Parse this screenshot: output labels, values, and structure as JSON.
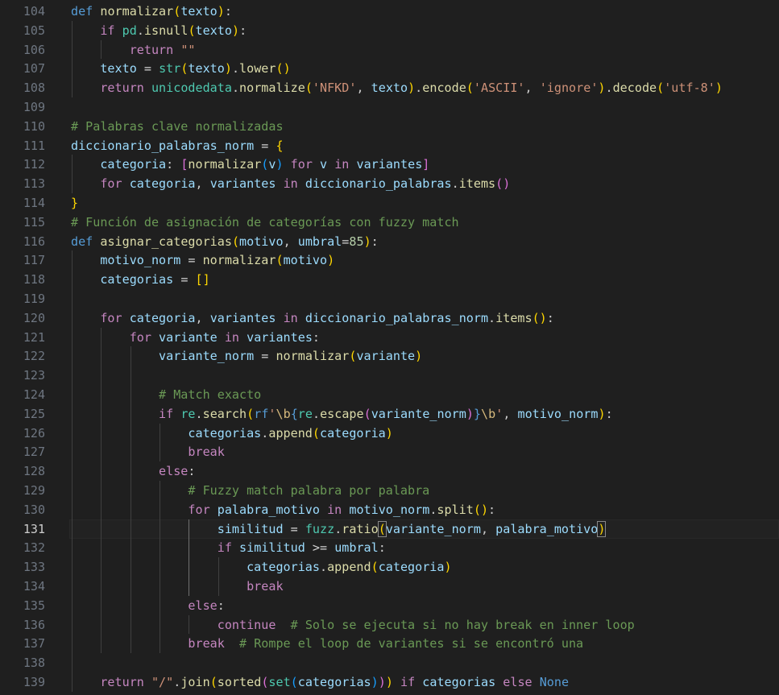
{
  "editor": {
    "active_line": 131,
    "colors": {
      "background": "#1f1f1f",
      "line_number": "#6e7681",
      "active_line_number": "#cccccc",
      "keyword": "#569cd6",
      "control": "#c586c0",
      "function": "#dcdcaa",
      "variable": "#9cdcfe",
      "string": "#ce9178",
      "number": "#b5cea8",
      "comment": "#6a9955"
    },
    "lines": [
      {
        "n": "104",
        "i": 0,
        "t": [
          [
            "kw",
            "def"
          ],
          [
            "plain",
            " "
          ],
          [
            "fn",
            "normalizar"
          ],
          [
            "p1",
            "("
          ],
          [
            "var",
            "texto"
          ],
          [
            "p1",
            ")"
          ],
          [
            "plain",
            ":"
          ]
        ]
      },
      {
        "n": "105",
        "i": 1,
        "t": [
          [
            "ctrl",
            "if"
          ],
          [
            "plain",
            " "
          ],
          [
            "cls",
            "pd"
          ],
          [
            "plain",
            "."
          ],
          [
            "fn",
            "isnull"
          ],
          [
            "p1",
            "("
          ],
          [
            "var",
            "texto"
          ],
          [
            "p1",
            ")"
          ],
          [
            "plain",
            ":"
          ]
        ]
      },
      {
        "n": "106",
        "i": 2,
        "t": [
          [
            "ctrl",
            "return"
          ],
          [
            "plain",
            " "
          ],
          [
            "str",
            "\"\""
          ]
        ]
      },
      {
        "n": "107",
        "i": 1,
        "t": [
          [
            "var",
            "texto"
          ],
          [
            "plain",
            " "
          ],
          [
            "op",
            "="
          ],
          [
            "plain",
            " "
          ],
          [
            "cls",
            "str"
          ],
          [
            "p1",
            "("
          ],
          [
            "var",
            "texto"
          ],
          [
            "p1",
            ")"
          ],
          [
            "plain",
            "."
          ],
          [
            "fn",
            "lower"
          ],
          [
            "p1",
            "()"
          ]
        ]
      },
      {
        "n": "108",
        "i": 1,
        "t": [
          [
            "ctrl",
            "return"
          ],
          [
            "plain",
            " "
          ],
          [
            "cls",
            "unicodedata"
          ],
          [
            "plain",
            "."
          ],
          [
            "fn",
            "normalize"
          ],
          [
            "p1",
            "("
          ],
          [
            "str",
            "'NFKD'"
          ],
          [
            "plain",
            ", "
          ],
          [
            "var",
            "texto"
          ],
          [
            "p1",
            ")"
          ],
          [
            "plain",
            "."
          ],
          [
            "fn",
            "encode"
          ],
          [
            "p1",
            "("
          ],
          [
            "str",
            "'ASCII'"
          ],
          [
            "plain",
            ", "
          ],
          [
            "str",
            "'ignore'"
          ],
          [
            "p1",
            ")"
          ],
          [
            "plain",
            "."
          ],
          [
            "fn",
            "decode"
          ],
          [
            "p1",
            "("
          ],
          [
            "str",
            "'utf-8'"
          ],
          [
            "p1",
            ")"
          ]
        ]
      },
      {
        "n": "109",
        "i": 0,
        "t": []
      },
      {
        "n": "110",
        "i": 0,
        "t": [
          [
            "cm",
            "# Palabras clave normalizadas"
          ]
        ]
      },
      {
        "n": "111",
        "i": 0,
        "t": [
          [
            "var",
            "diccionario_palabras_norm"
          ],
          [
            "plain",
            " "
          ],
          [
            "op",
            "="
          ],
          [
            "plain",
            " "
          ],
          [
            "p1",
            "{"
          ]
        ]
      },
      {
        "n": "112",
        "i": 1,
        "t": [
          [
            "var",
            "categoria"
          ],
          [
            "plain",
            ": "
          ],
          [
            "p2",
            "["
          ],
          [
            "fn",
            "normalizar"
          ],
          [
            "p3",
            "("
          ],
          [
            "var",
            "v"
          ],
          [
            "p3",
            ")"
          ],
          [
            "plain",
            " "
          ],
          [
            "ctrl",
            "for"
          ],
          [
            "plain",
            " "
          ],
          [
            "var",
            "v"
          ],
          [
            "plain",
            " "
          ],
          [
            "ctrl",
            "in"
          ],
          [
            "plain",
            " "
          ],
          [
            "var",
            "variantes"
          ],
          [
            "p2",
            "]"
          ]
        ]
      },
      {
        "n": "113",
        "i": 1,
        "t": [
          [
            "ctrl",
            "for"
          ],
          [
            "plain",
            " "
          ],
          [
            "var",
            "categoria"
          ],
          [
            "plain",
            ", "
          ],
          [
            "var",
            "variantes"
          ],
          [
            "plain",
            " "
          ],
          [
            "ctrl",
            "in"
          ],
          [
            "plain",
            " "
          ],
          [
            "var",
            "diccionario_palabras"
          ],
          [
            "plain",
            "."
          ],
          [
            "fn",
            "items"
          ],
          [
            "p2",
            "()"
          ]
        ]
      },
      {
        "n": "114",
        "i": 0,
        "t": [
          [
            "p1",
            "}"
          ]
        ]
      },
      {
        "n": "115",
        "i": 0,
        "t": [
          [
            "cm",
            "# Función de asignación de categorías con fuzzy match"
          ]
        ]
      },
      {
        "n": "116",
        "i": 0,
        "t": [
          [
            "kw",
            "def"
          ],
          [
            "plain",
            " "
          ],
          [
            "fn",
            "asignar_categorias"
          ],
          [
            "p1",
            "("
          ],
          [
            "var",
            "motivo"
          ],
          [
            "plain",
            ", "
          ],
          [
            "var",
            "umbral"
          ],
          [
            "op",
            "="
          ],
          [
            "num",
            "85"
          ],
          [
            "p1",
            ")"
          ],
          [
            "plain",
            ":"
          ]
        ]
      },
      {
        "n": "117",
        "i": 1,
        "t": [
          [
            "var",
            "motivo_norm"
          ],
          [
            "plain",
            " "
          ],
          [
            "op",
            "="
          ],
          [
            "plain",
            " "
          ],
          [
            "fn",
            "normalizar"
          ],
          [
            "p1",
            "("
          ],
          [
            "var",
            "motivo"
          ],
          [
            "p1",
            ")"
          ]
        ]
      },
      {
        "n": "118",
        "i": 1,
        "t": [
          [
            "var",
            "categorias"
          ],
          [
            "plain",
            " "
          ],
          [
            "op",
            "="
          ],
          [
            "plain",
            " "
          ],
          [
            "p1",
            "[]"
          ]
        ]
      },
      {
        "n": "119",
        "i": 1,
        "t": []
      },
      {
        "n": "120",
        "i": 1,
        "t": [
          [
            "ctrl",
            "for"
          ],
          [
            "plain",
            " "
          ],
          [
            "var",
            "categoria"
          ],
          [
            "plain",
            ", "
          ],
          [
            "var",
            "variantes"
          ],
          [
            "plain",
            " "
          ],
          [
            "ctrl",
            "in"
          ],
          [
            "plain",
            " "
          ],
          [
            "var",
            "diccionario_palabras_norm"
          ],
          [
            "plain",
            "."
          ],
          [
            "fn",
            "items"
          ],
          [
            "p1",
            "()"
          ],
          [
            "plain",
            ":"
          ]
        ]
      },
      {
        "n": "121",
        "i": 2,
        "t": [
          [
            "ctrl",
            "for"
          ],
          [
            "plain",
            " "
          ],
          [
            "var",
            "variante"
          ],
          [
            "plain",
            " "
          ],
          [
            "ctrl",
            "in"
          ],
          [
            "plain",
            " "
          ],
          [
            "var",
            "variantes"
          ],
          [
            "plain",
            ":"
          ]
        ]
      },
      {
        "n": "122",
        "i": 3,
        "t": [
          [
            "var",
            "variante_norm"
          ],
          [
            "plain",
            " "
          ],
          [
            "op",
            "="
          ],
          [
            "plain",
            " "
          ],
          [
            "fn",
            "normalizar"
          ],
          [
            "p1",
            "("
          ],
          [
            "var",
            "variante"
          ],
          [
            "p1",
            ")"
          ]
        ]
      },
      {
        "n": "123",
        "i": 3,
        "t": []
      },
      {
        "n": "124",
        "i": 3,
        "t": [
          [
            "cm",
            "# Match exacto"
          ]
        ]
      },
      {
        "n": "125",
        "i": 3,
        "t": [
          [
            "ctrl",
            "if"
          ],
          [
            "plain",
            " "
          ],
          [
            "cls",
            "re"
          ],
          [
            "plain",
            "."
          ],
          [
            "fn",
            "search"
          ],
          [
            "p1",
            "("
          ],
          [
            "kw",
            "rf"
          ],
          [
            "str",
            "'"
          ],
          [
            "esc",
            "\\b"
          ],
          [
            "kw",
            "{"
          ],
          [
            "cls",
            "re"
          ],
          [
            "plain",
            "."
          ],
          [
            "fn",
            "escape"
          ],
          [
            "p2",
            "("
          ],
          [
            "var",
            "variante_norm"
          ],
          [
            "p2",
            ")"
          ],
          [
            "kw",
            "}"
          ],
          [
            "esc",
            "\\b"
          ],
          [
            "str",
            "'"
          ],
          [
            "plain",
            ", "
          ],
          [
            "var",
            "motivo_norm"
          ],
          [
            "p1",
            ")"
          ],
          [
            "plain",
            ":"
          ]
        ]
      },
      {
        "n": "126",
        "i": 4,
        "t": [
          [
            "var",
            "categorias"
          ],
          [
            "plain",
            "."
          ],
          [
            "fn",
            "append"
          ],
          [
            "p1",
            "("
          ],
          [
            "var",
            "categoria"
          ],
          [
            "p1",
            ")"
          ]
        ]
      },
      {
        "n": "127",
        "i": 4,
        "t": [
          [
            "ctrl",
            "break"
          ]
        ]
      },
      {
        "n": "128",
        "i": 3,
        "t": [
          [
            "ctrl",
            "else"
          ],
          [
            "plain",
            ":"
          ]
        ]
      },
      {
        "n": "129",
        "i": 4,
        "t": [
          [
            "cm",
            "# Fuzzy match palabra por palabra"
          ]
        ]
      },
      {
        "n": "130",
        "i": 4,
        "t": [
          [
            "ctrl",
            "for"
          ],
          [
            "plain",
            " "
          ],
          [
            "var",
            "palabra_motivo"
          ],
          [
            "plain",
            " "
          ],
          [
            "ctrl",
            "in"
          ],
          [
            "plain",
            " "
          ],
          [
            "var",
            "motivo_norm"
          ],
          [
            "plain",
            "."
          ],
          [
            "fn",
            "split"
          ],
          [
            "p1",
            "()"
          ],
          [
            "plain",
            ":"
          ]
        ]
      },
      {
        "n": "131",
        "i": 5,
        "t": [
          [
            "var",
            "similitud"
          ],
          [
            "plain",
            " "
          ],
          [
            "op",
            "="
          ],
          [
            "plain",
            " "
          ],
          [
            "cls",
            "fuzz"
          ],
          [
            "plain",
            "."
          ],
          [
            "fn",
            "ratio"
          ],
          [
            "p1b",
            "("
          ],
          [
            "var",
            "variante_norm"
          ],
          [
            "plain",
            ", "
          ],
          [
            "var",
            "palabra_motivo"
          ],
          [
            "p1b",
            ")"
          ]
        ]
      },
      {
        "n": "132",
        "i": 5,
        "t": [
          [
            "ctrl",
            "if"
          ],
          [
            "plain",
            " "
          ],
          [
            "var",
            "similitud"
          ],
          [
            "plain",
            " "
          ],
          [
            "op",
            ">="
          ],
          [
            "plain",
            " "
          ],
          [
            "var",
            "umbral"
          ],
          [
            "plain",
            ":"
          ]
        ]
      },
      {
        "n": "133",
        "i": 6,
        "t": [
          [
            "var",
            "categorias"
          ],
          [
            "plain",
            "."
          ],
          [
            "fn",
            "append"
          ],
          [
            "p1",
            "("
          ],
          [
            "var",
            "categoria"
          ],
          [
            "p1",
            ")"
          ]
        ]
      },
      {
        "n": "134",
        "i": 6,
        "t": [
          [
            "ctrl",
            "break"
          ]
        ]
      },
      {
        "n": "135",
        "i": 4,
        "t": [
          [
            "ctrl",
            "else"
          ],
          [
            "plain",
            ":"
          ]
        ]
      },
      {
        "n": "136",
        "i": 5,
        "t": [
          [
            "ctrl",
            "continue"
          ],
          [
            "plain",
            "  "
          ],
          [
            "cm",
            "# Solo se ejecuta si no hay break en inner loop"
          ]
        ]
      },
      {
        "n": "137",
        "i": 4,
        "t": [
          [
            "ctrl",
            "break"
          ],
          [
            "plain",
            "  "
          ],
          [
            "cm",
            "# Rompe el loop de variantes si se encontró una"
          ]
        ]
      },
      {
        "n": "138",
        "i": 1,
        "t": []
      },
      {
        "n": "139",
        "i": 1,
        "t": [
          [
            "ctrl",
            "return"
          ],
          [
            "plain",
            " "
          ],
          [
            "str",
            "\"/\""
          ],
          [
            "plain",
            "."
          ],
          [
            "fn",
            "join"
          ],
          [
            "p1",
            "("
          ],
          [
            "fn",
            "sorted"
          ],
          [
            "p2",
            "("
          ],
          [
            "cls",
            "set"
          ],
          [
            "p3",
            "("
          ],
          [
            "var",
            "categorias"
          ],
          [
            "p3",
            ")"
          ],
          [
            "p2",
            ")"
          ],
          [
            "p1",
            ")"
          ],
          [
            "plain",
            " "
          ],
          [
            "ctrl",
            "if"
          ],
          [
            "plain",
            " "
          ],
          [
            "var",
            "categorias"
          ],
          [
            "plain",
            " "
          ],
          [
            "ctrl",
            "else"
          ],
          [
            "plain",
            " "
          ],
          [
            "kw",
            "None"
          ]
        ]
      }
    ]
  }
}
